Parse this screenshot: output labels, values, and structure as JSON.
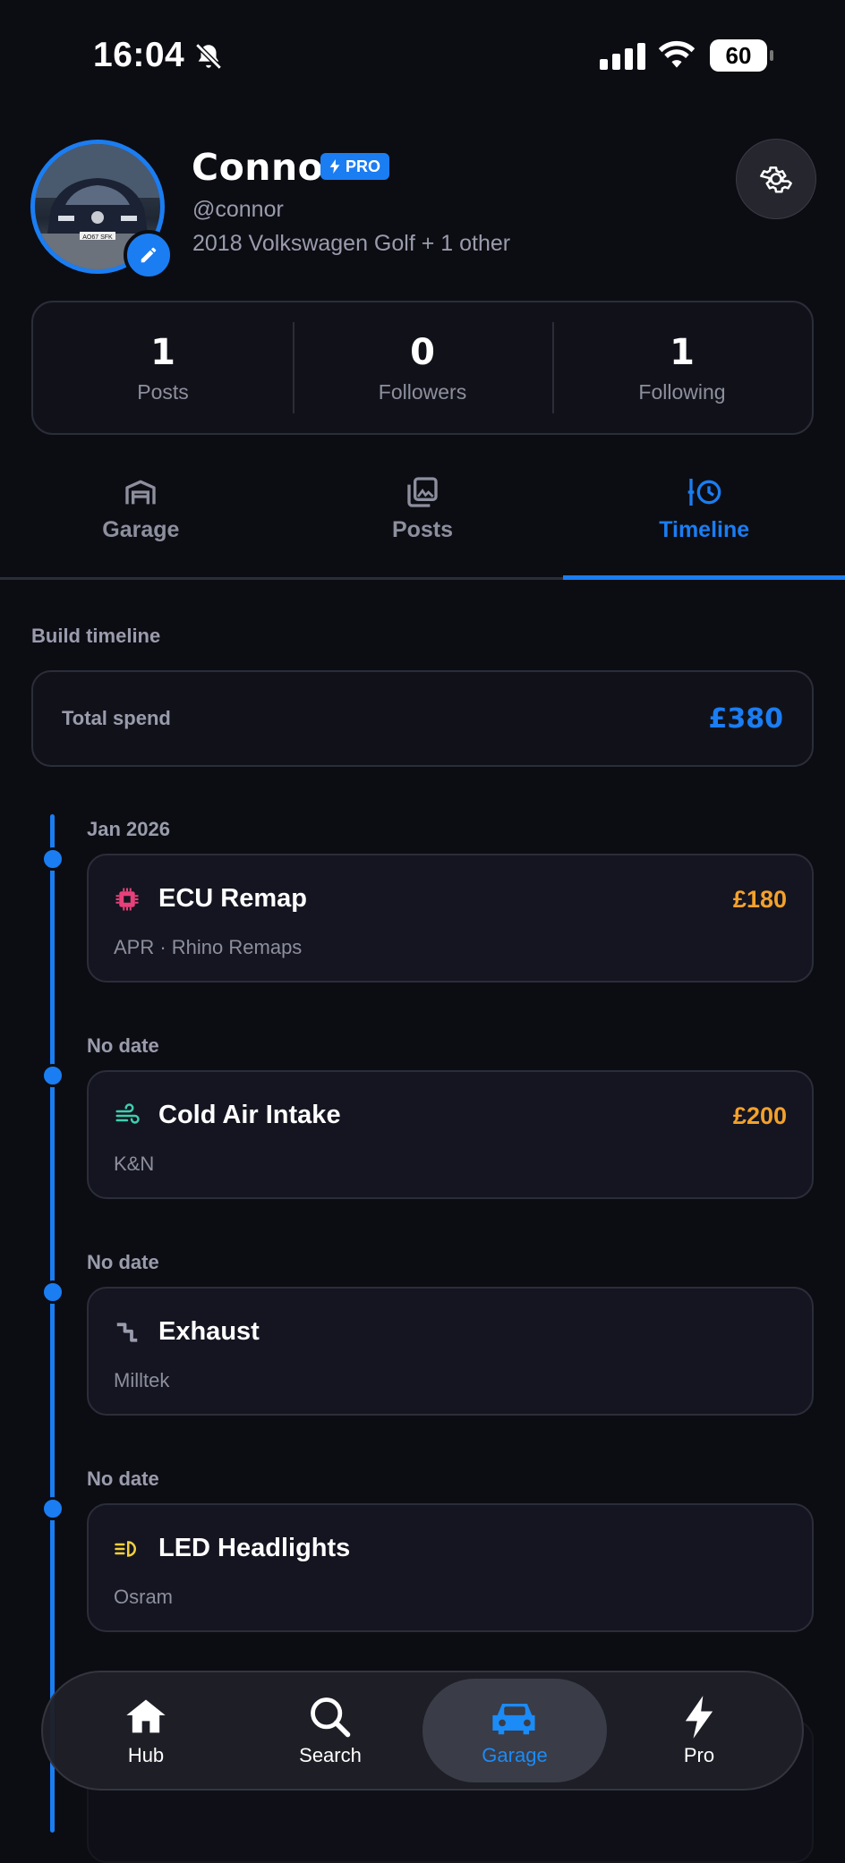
{
  "status_bar": {
    "time": "16:04",
    "battery": "60"
  },
  "profile": {
    "name": "Connor",
    "badge": "PRO",
    "handle": "@connor",
    "vehicle": "2018 Volkswagen Golf + 1 other",
    "avatar_plate": "AO67 SFK"
  },
  "stats": [
    {
      "value": "1",
      "label": "Posts"
    },
    {
      "value": "0",
      "label": "Followers"
    },
    {
      "value": "1",
      "label": "Following"
    }
  ],
  "tabs": [
    {
      "label": "Garage",
      "icon": "garage-icon"
    },
    {
      "label": "Posts",
      "icon": "gallery-icon"
    },
    {
      "label": "Timeline",
      "icon": "timeline-icon",
      "active": true
    }
  ],
  "timeline": {
    "section_title": "Build timeline",
    "total_spend_label": "Total spend",
    "total_spend_value": "£380",
    "entries": [
      {
        "date": "Jan 2026",
        "title": "ECU Remap",
        "subtitle": "APR · Rhino Remaps",
        "price": "£180",
        "icon": "chip-icon",
        "icon_color": "#e8407a"
      },
      {
        "date": "No date",
        "title": "Cold Air Intake",
        "subtitle": "K&N",
        "price": "£200",
        "icon": "wind-icon",
        "icon_color": "#3fcfb0"
      },
      {
        "date": "No date",
        "title": "Exhaust",
        "subtitle": "Milltek",
        "price": "",
        "icon": "exhaust-icon",
        "icon_color": "#9a9cad"
      },
      {
        "date": "No date",
        "title": "LED Headlights",
        "subtitle": "Osram",
        "price": "",
        "icon": "headlight-icon",
        "icon_color": "#f4d03f"
      }
    ]
  },
  "nav": [
    {
      "label": "Hub",
      "icon": "home-icon"
    },
    {
      "label": "Search",
      "icon": "search-icon"
    },
    {
      "label": "Garage",
      "icon": "car-icon",
      "active": true
    },
    {
      "label": "Pro",
      "icon": "bolt-icon"
    }
  ],
  "colors": {
    "accent": "#1b7df2",
    "price": "#f3a12c",
    "background": "#0c0d13"
  }
}
